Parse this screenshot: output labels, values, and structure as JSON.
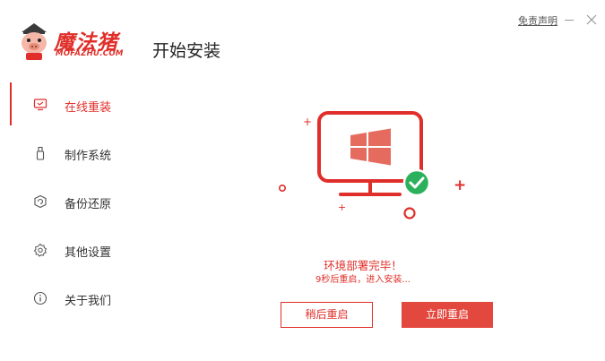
{
  "header": {
    "logo_text": "魔法猪",
    "logo_sub": "MOFAZHU.COM",
    "page_title": "开始安装",
    "disclaimer": "免责声明"
  },
  "sidebar": {
    "items": [
      {
        "label": "在线重装",
        "icon": "monitor-icon",
        "active": true
      },
      {
        "label": "制作系统",
        "icon": "usb-icon",
        "active": false
      },
      {
        "label": "备份还原",
        "icon": "backup-icon",
        "active": false
      },
      {
        "label": "其他设置",
        "icon": "gear-icon",
        "active": false
      },
      {
        "label": "关于我们",
        "icon": "info-icon",
        "active": false
      }
    ]
  },
  "main": {
    "status_title": "环境部署完毕！",
    "status_sub": "9秒后重启，进入安装...",
    "btn_later": "稍后重启",
    "btn_now": "立即重启"
  },
  "colors": {
    "accent": "#e02f2a",
    "success": "#2bb15c"
  }
}
